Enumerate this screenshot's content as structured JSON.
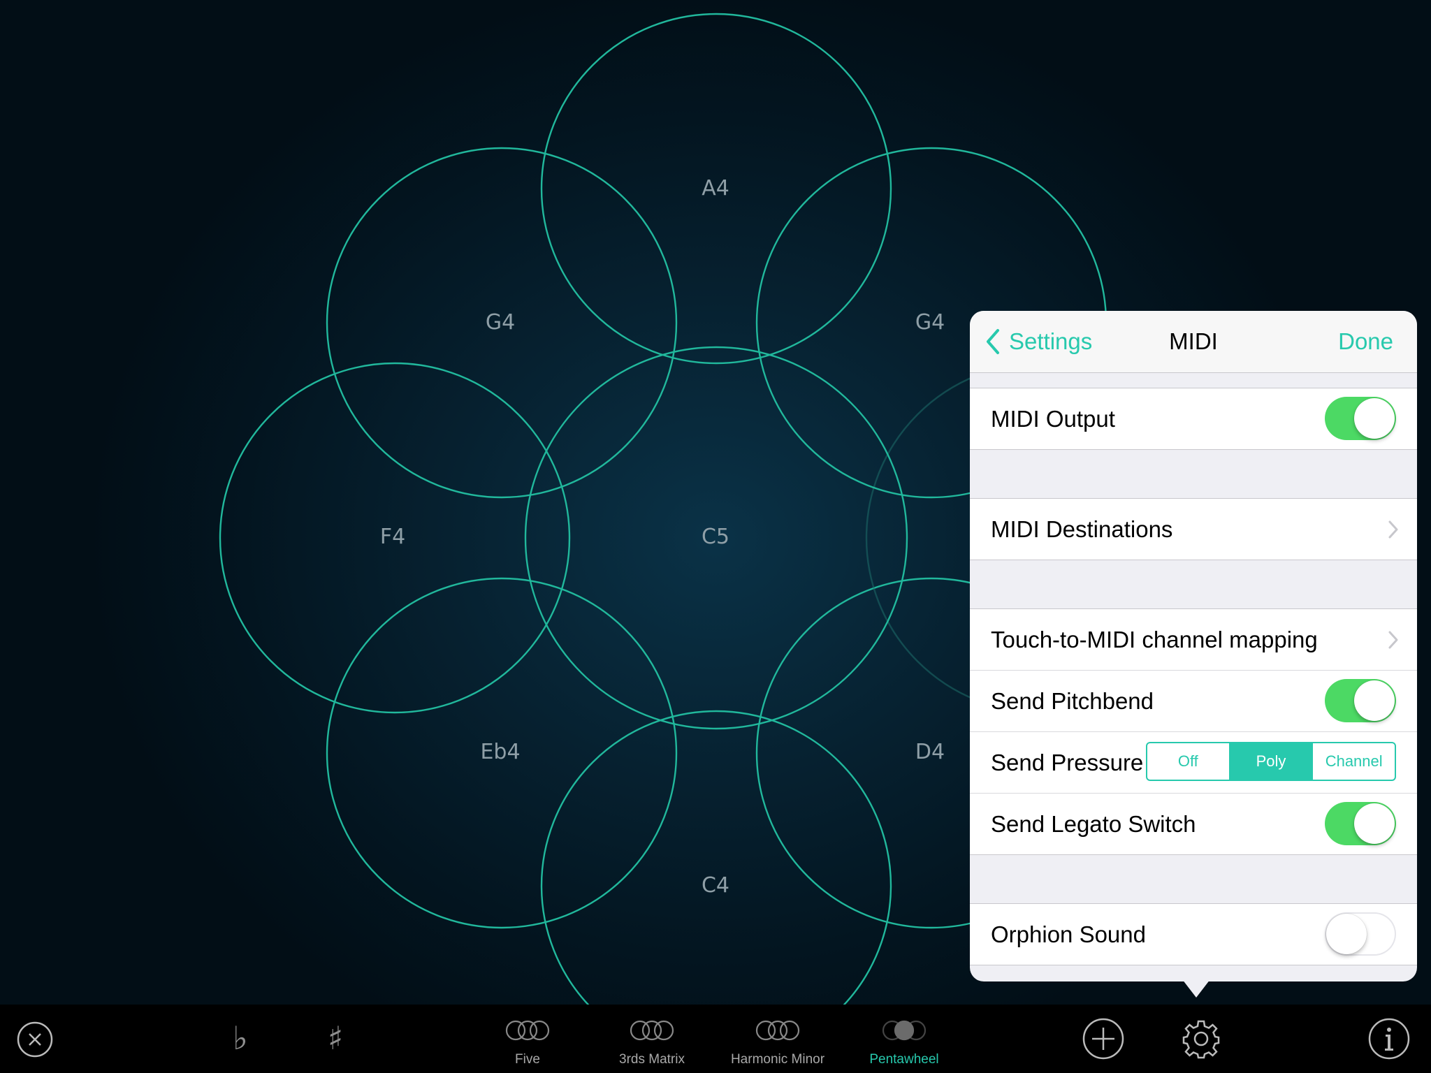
{
  "wheel": {
    "notes": {
      "top": "A4",
      "upper_left": "G4",
      "upper_right": "G4",
      "left": "F4",
      "center": "C5",
      "lower_left": "Eb4",
      "lower_right": "D4",
      "bottom": "C4"
    }
  },
  "toolbar": {
    "presets": [
      {
        "label": "Five",
        "active": false
      },
      {
        "label": "3rds Matrix",
        "active": false
      },
      {
        "label": "Harmonic Minor",
        "active": false
      },
      {
        "label": "Pentawheel",
        "active": true
      }
    ],
    "icons": {
      "close": "close-circle-icon",
      "flat": "♭",
      "sharp": "♯",
      "add": "plus-circle-icon",
      "settings": "gear-icon",
      "info": "info-icon"
    }
  },
  "popover": {
    "back_label": "Settings",
    "title": "MIDI",
    "done_label": "Done",
    "rows": {
      "midi_output": {
        "label": "MIDI Output",
        "on": true
      },
      "midi_destinations": {
        "label": "MIDI Destinations"
      },
      "touch_mapping": {
        "label": "Touch-to-MIDI channel mapping"
      },
      "send_pitchbend": {
        "label": "Send Pitchbend",
        "on": true
      },
      "send_pressure": {
        "label": "Send Pressure",
        "options": [
          "Off",
          "Poly",
          "Channel"
        ],
        "selected": "Poly"
      },
      "send_legato": {
        "label": "Send Legato Switch",
        "on": true
      },
      "orphion_sound": {
        "label": "Orphion Sound",
        "on": false
      }
    }
  },
  "colors": {
    "accent": "#27c9ad",
    "ring": "#21b89c",
    "toggle_on": "#4cd964",
    "background": "#031520"
  }
}
